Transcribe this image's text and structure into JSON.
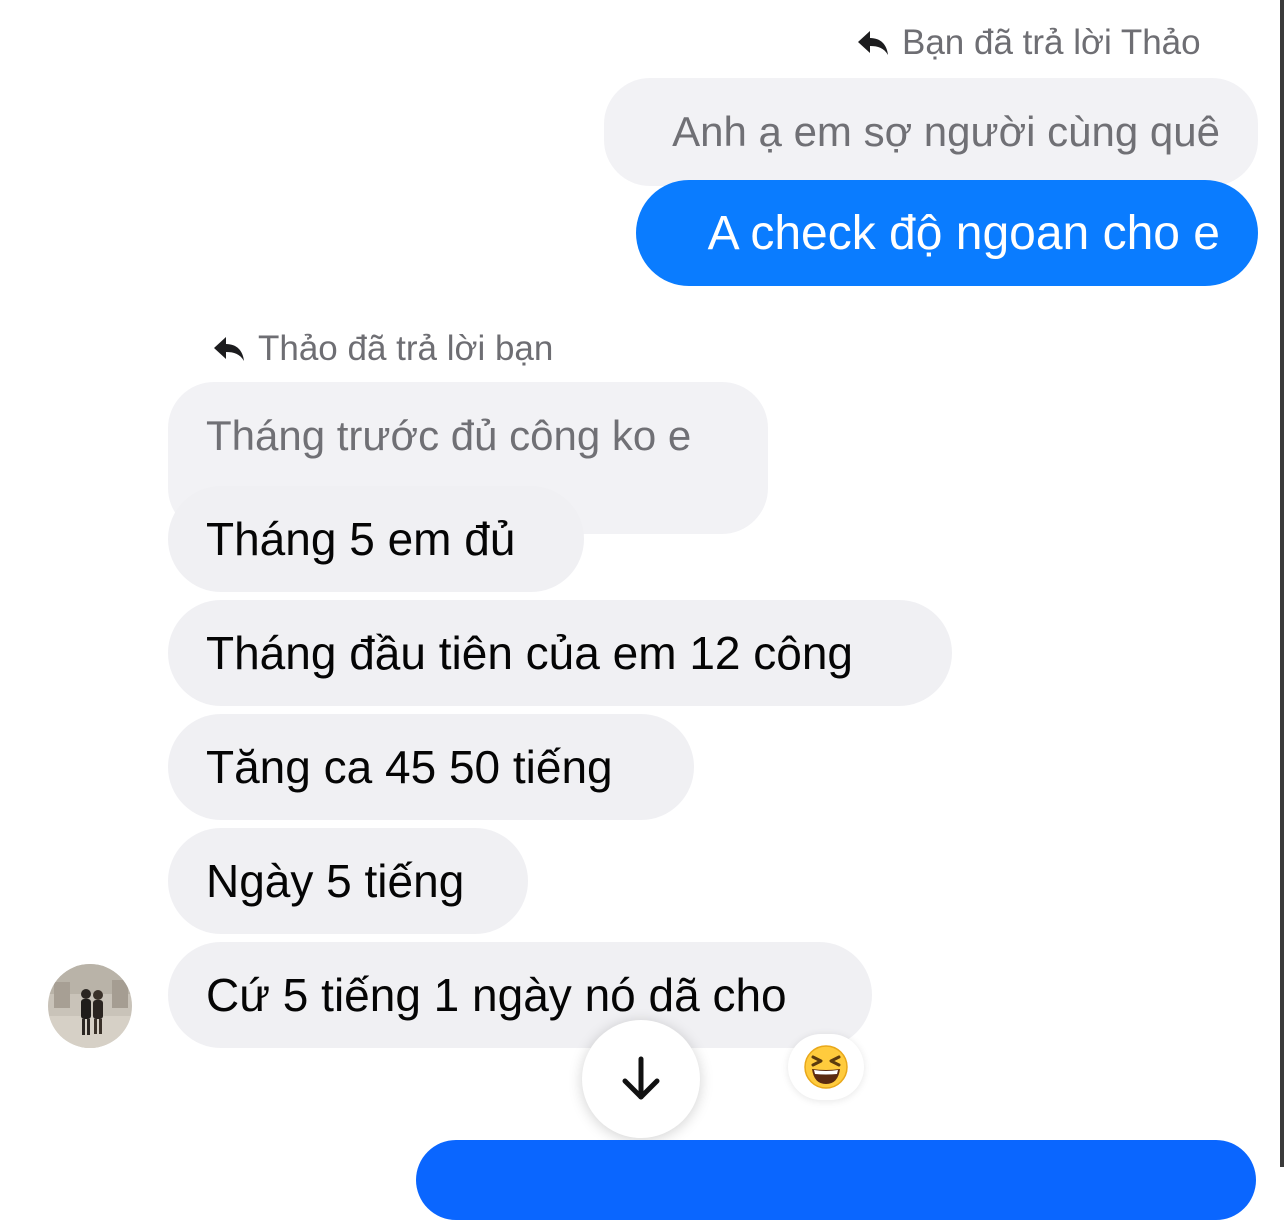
{
  "thread": {
    "reply_label_sent": "Bạn đã trả lời Thảo",
    "quoted_sent": "Anh ạ em sợ người cùng quê",
    "sent_message": "A check độ ngoan cho e",
    "reply_label_received": "Thảo đã trả lời bạn",
    "quoted_received": "Tháng trước đủ công ko e",
    "received": [
      "Tháng 5 em đủ",
      "Tháng đầu tiên của em 12 công",
      "Tăng ca 45 50 tiếng",
      "Ngày 5 tiếng",
      "Cứ 5 tiếng 1 ngày nó dã cho"
    ]
  },
  "icons": {
    "reply": "reply-arrow-icon",
    "scroll": "arrow-down-icon",
    "reaction": "laughing-emoji-icon",
    "avatar": "contact-avatar"
  },
  "colors": {
    "sent_bubble": "#0a7cff",
    "received_bubble": "#f0f0f3",
    "quoted_bubble": "#f2f2f5",
    "meta_text": "#6e6e73"
  }
}
